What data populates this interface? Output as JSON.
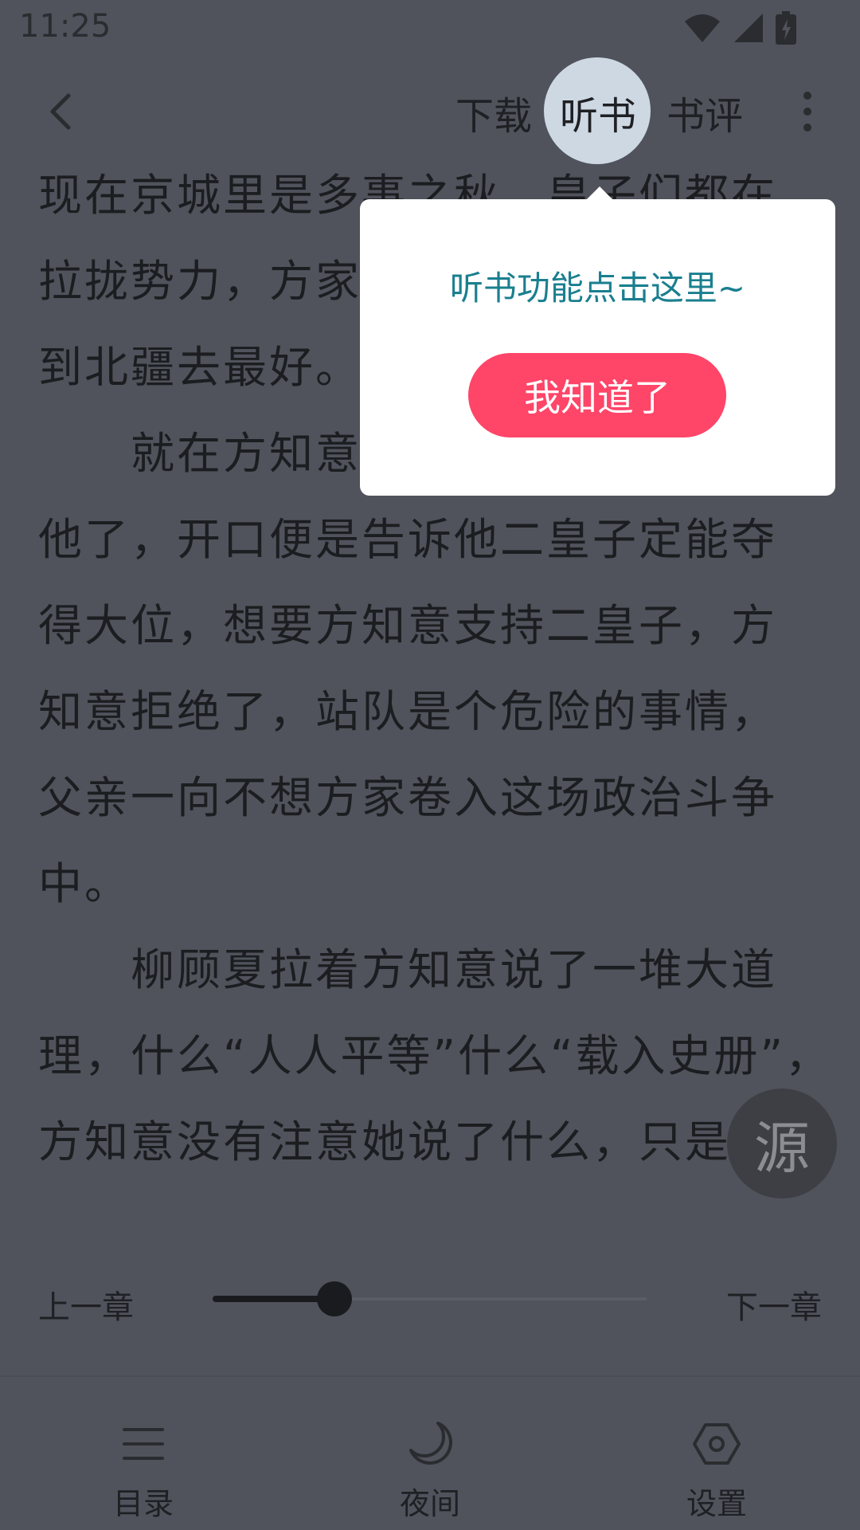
{
  "status_bar": {
    "time": "11:25"
  },
  "toolbar": {
    "download": "下载",
    "listen": "听书",
    "review": "书评"
  },
  "content": {
    "lines": [
      "现在京城里是多事之秋，皇子们都在",
      "拉拢势力，方家",
      "到北疆去最好。",
      "　　就在方知意",
      "他了，开口便是告诉他二皇子定能夺",
      "得大位，想要方知意支持二皇子，方",
      "知意拒绝了，站队是个危险的事情，",
      "父亲一向不想方家卷入这场政治斗争",
      "中。",
      "　　柳顾夏拉着方知意说了一堆大道",
      "理，什么“人人平等”什么“载入史册”，",
      "方知意没有注意她说了什么，只是"
    ]
  },
  "popup": {
    "message": "听书功能点击这里~",
    "button": "我知道了"
  },
  "source_button": "源",
  "chapter_nav": {
    "prev": "上一章",
    "next": "下一章",
    "progress": 0.28
  },
  "bottom_nav": {
    "items": [
      {
        "label": "目录",
        "icon": "menu-icon"
      },
      {
        "label": "夜间",
        "icon": "moon-icon"
      },
      {
        "label": "设置",
        "icon": "settings-icon"
      }
    ]
  },
  "colors": {
    "overlay": "#50535c",
    "accent": "#ff4568",
    "popup_text": "#1a7f8f",
    "highlight": "#cdd8e3"
  }
}
